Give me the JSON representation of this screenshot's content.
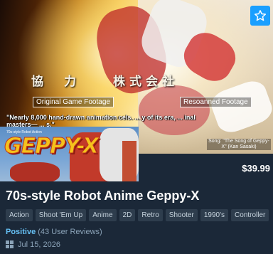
{
  "capsule": {
    "credits_text": "協　力　　株式会社",
    "left_label": "Original Game Footage",
    "right_label": "Resoanned Footage",
    "quote": "\"Nearly 8,000 hand-drawn animation cels. ... y of its era, ... inal masters— ... s.\"",
    "song_caption": "Song: \"The Song of Geppy-X\" (Kan Sasaki)",
    "keyart_subtitle": "70s-style Robot Action",
    "keyart_logo": "GEPPY-X",
    "wishlist_icon": "star-icon"
  },
  "price": "$39.99",
  "title": "70s-style Robot Anime Geppy-X",
  "tags": [
    "Action",
    "Shoot 'Em Up",
    "Anime",
    "2D",
    "Retro",
    "Shooter",
    "1990's",
    "Controller"
  ],
  "review": {
    "summary": "Positive",
    "count": "(43 User Reviews)"
  },
  "release": {
    "platform_icon": "windows-icon",
    "date": "Jul 15, 2026"
  },
  "colors": {
    "background": "#1b2838",
    "accent": "#1a9fff",
    "positive": "#66c0f4",
    "tag_bg": "#2e3d4d"
  }
}
